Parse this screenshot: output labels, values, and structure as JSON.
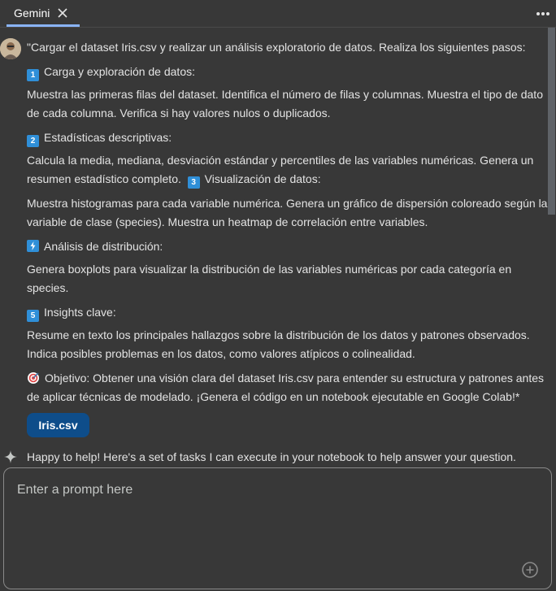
{
  "tab": {
    "title": "Gemini"
  },
  "message": {
    "intro": "\"Cargar el dataset Iris.csv y realizar un análisis exploratorio de datos. Realiza los siguientes pasos:",
    "step1_num": "1",
    "step1_title": "Carga y exploración de datos:",
    "step1_line1": "Muestra las primeras filas del dataset. Identifica el número de filas y columnas. Muestra el tipo de dato",
    "step1_line2": "de cada columna. Verifica si hay valores nulos o duplicados.",
    "step2_num": "2",
    "step2_title": "Estadísticas descriptivas:",
    "step2_line1": "Calcula la media, mediana, desviación estándar y percentiles de las variables numéricas. Genera un",
    "step2_line2": "resumen estadístico completo.",
    "step3_num": "3",
    "step3_title": "Visualización de datos:",
    "step3_line1": "Muestra histogramas para cada variable numérica. Genera un gráfico de dispersión coloreado según la",
    "step3_line2": "variable de clase (species). Muestra un heatmap de correlación entre variables.",
    "step4_title": "Análisis de distribución:",
    "step4_line1": "Genera boxplots para visualizar la distribución de las variables numéricas por cada categoría en",
    "step4_line2": "species.",
    "step5_num": "5",
    "step5_title": "Insights clave:",
    "step5_line1": "Resume en texto los principales hallazgos sobre la distribución de los datos y patrones observados.",
    "step5_line2": "Indica posibles problemas en los datos, como valores atípicos o colinealidad.",
    "objective_line1": "Objetivo: Obtener una visión clara del dataset Iris.csv para entender su estructura y patrones antes",
    "objective_line2": "de aplicar técnicas de modelado. ¡Genera el código en un notebook ejecutable en Google Colab!*",
    "attachment": "Iris.csv"
  },
  "reply": {
    "text": "Happy to help! Here's a set of tasks I can execute in your notebook to help answer your question."
  },
  "prompt": {
    "placeholder": "Enter a prompt here"
  }
}
